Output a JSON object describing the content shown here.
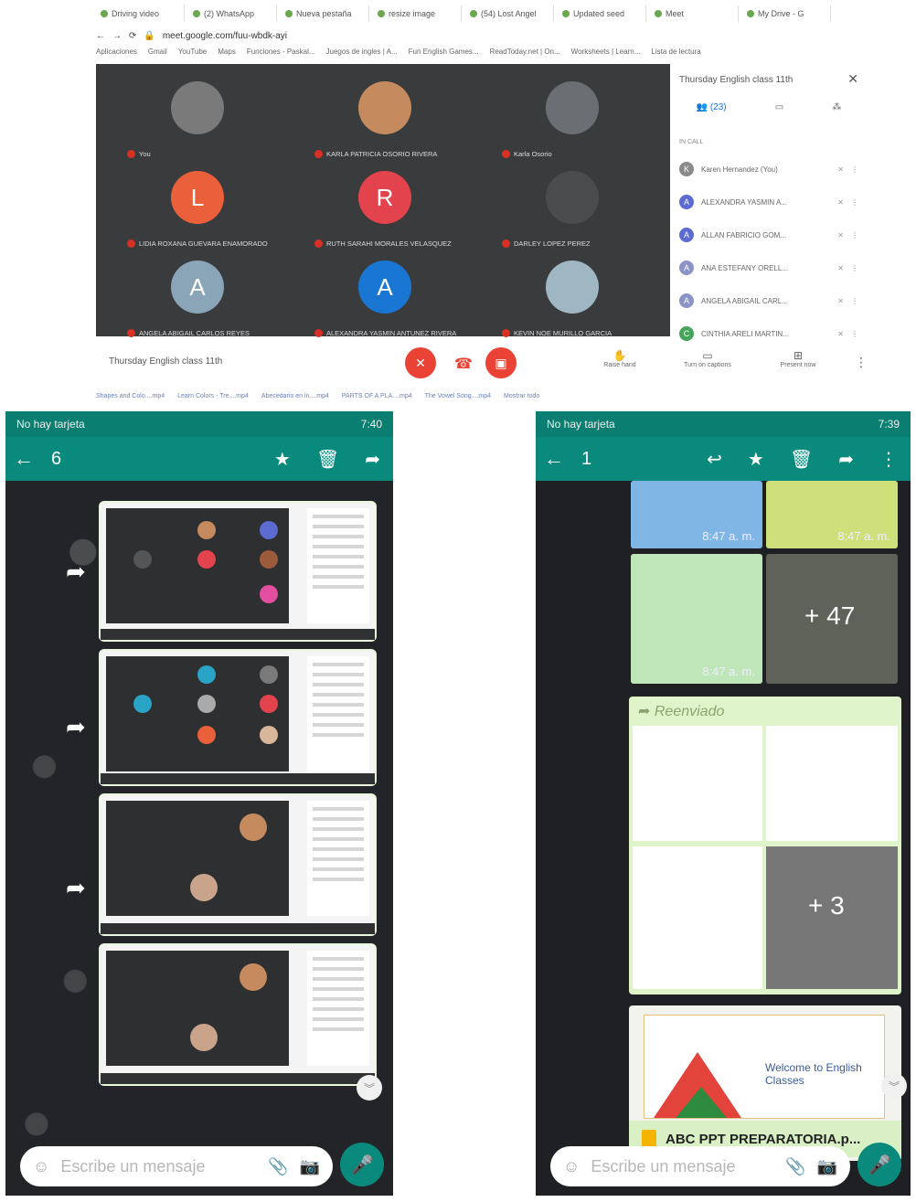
{
  "browser": {
    "tabs": [
      "Driving video",
      "(2) WhatsApp",
      "Nueva pestaña",
      "resize image",
      "(54) Lost Angel",
      "Updated seed",
      "Meet",
      "My Drive - G"
    ],
    "url": "meet.google.com/fuu-wbdk-ayi",
    "bookmarks": [
      "Aplicaciones",
      "Gmail",
      "YouTube",
      "Maps",
      "Funciones - Paskal...",
      "Juegos de ingles | A...",
      "Fun English Games...",
      "ReadToday.net | On...",
      "Worksheets | Learn...",
      "Lista de lectura"
    ]
  },
  "meet": {
    "participants": [
      {
        "name": "You",
        "initial": "",
        "color": "#7a7a7a"
      },
      {
        "name": "KARLA PATRICIA OSORIO RIVERA",
        "initial": "",
        "color": "#c58b5e"
      },
      {
        "name": "Karla Osorio",
        "initial": "",
        "color": "#6b6f73"
      },
      {
        "name": "LIDIA ROXANA GUEVARA ENAMORADO",
        "initial": "L",
        "color": "#e9603a"
      },
      {
        "name": "RUTH SARAHI MORALES VELASQUEZ",
        "initial": "R",
        "color": "#e2434d"
      },
      {
        "name": "DARLEY LOPEZ PEREZ",
        "initial": "",
        "color": "#4b4c4e"
      },
      {
        "name": "ANGELA ABIGAIL CARLOS REYES",
        "initial": "A",
        "color": "#8aa4b8"
      },
      {
        "name": "ALEXANDRA YASMIN ANTUNEZ RIVERA",
        "initial": "A",
        "color": "#1976d2"
      },
      {
        "name": "KEVIN NOE MURILLO GARCIA",
        "initial": "",
        "color": "#9fb6c3"
      }
    ],
    "panel": {
      "title": "Thursday English class 11th",
      "close": "✕",
      "tab_people": "(23)",
      "in_call": "IN CALL",
      "people": [
        {
          "name": "Karen Hernandez (You)",
          "initial": "K",
          "color": "#8a8a8a"
        },
        {
          "name": "ALEXANDRA YASMIN A...",
          "initial": "A",
          "color": "#5b6bd1"
        },
        {
          "name": "ALLAN FABRICIO GOM...",
          "initial": "A",
          "color": "#5b6bd1"
        },
        {
          "name": "ANA ESTEFANY ORELL...",
          "initial": "A",
          "color": "#8b94c9"
        },
        {
          "name": "ANGELA ABIGAIL CARL...",
          "initial": "A",
          "color": "#8b94c9"
        },
        {
          "name": "CINTHIA ARELI MARTIN...",
          "initial": "C",
          "color": "#45a35a"
        }
      ]
    },
    "controls": {
      "meeting_title": "Thursday English class 11th",
      "raise_hand": "Raise hand",
      "captions": "Turn on captions",
      "present": "Present now"
    },
    "downloads": [
      "Shapes and Colo....mp4",
      "Learn Colors - Tre....mp4",
      "Abecedario en in....mp4",
      "PARTS OF A PLA....mp4",
      "The Vowel Song....mp4",
      "Mostrar todo"
    ]
  },
  "phone_left": {
    "status_left": "No hay tarjeta",
    "status_right": "7:40",
    "selected_count": "6",
    "composer_placeholder": "Escribe un mensaje"
  },
  "phone_right": {
    "status_left": "No hay tarjeta",
    "status_right": "7:39",
    "selected_count": "1",
    "time1": "8:47 a. m.",
    "time2": "8:47 a. m.",
    "time3": "8:47 a. m.",
    "more_images": "+ 47",
    "forwarded": "Reenviado",
    "more_docs": "+ 3",
    "doc_name": "ABC PPT PREPARATORIA.p...",
    "welcome": "Welcome to English Classes",
    "composer_placeholder": "Escribe un mensaje"
  }
}
